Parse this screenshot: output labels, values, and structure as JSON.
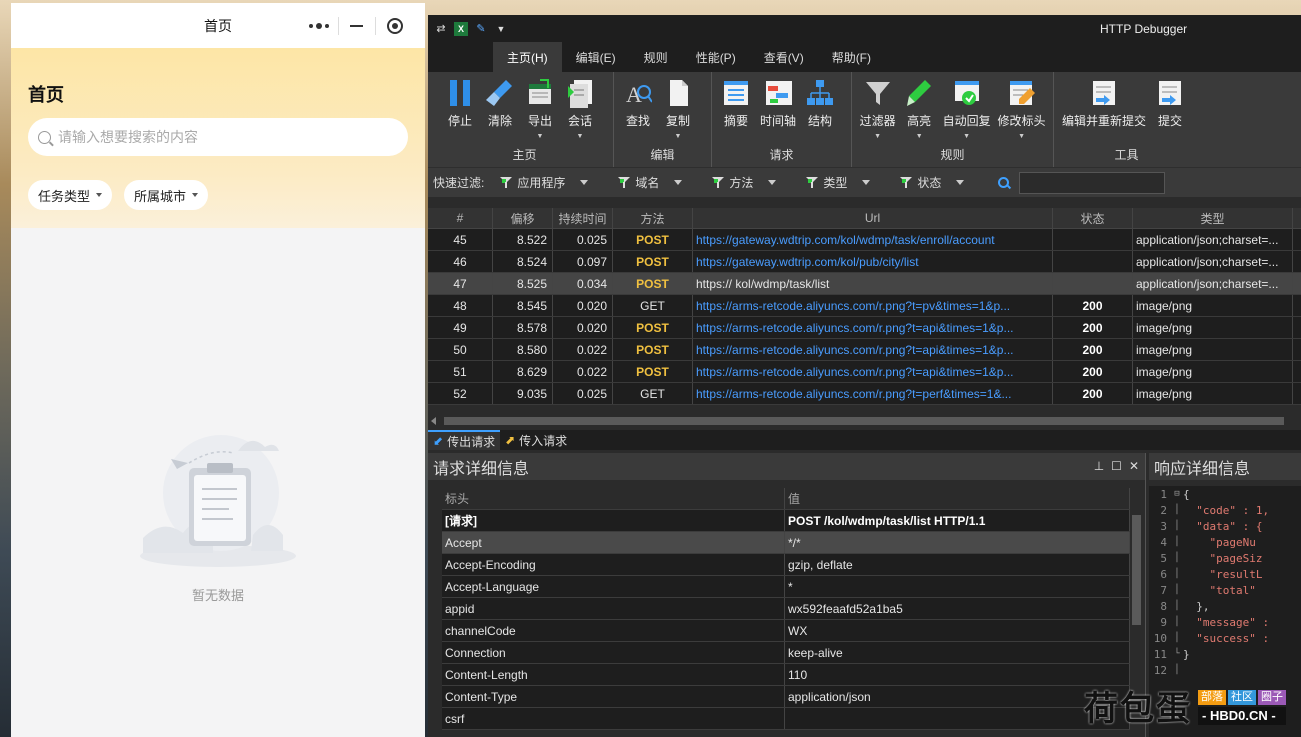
{
  "miniprogram": {
    "nav_title": "首页",
    "page_heading": "首页",
    "search_placeholder": "请输入想要搜索的内容",
    "filters": [
      "任务类型",
      "所属城市"
    ],
    "empty_text": "暂无数据",
    "capsule_icons": [
      "more-dots-icon",
      "minimize-icon",
      "close-target-icon"
    ]
  },
  "debugger": {
    "title": "HTTP Debugger",
    "menu": [
      "主页(H)",
      "编辑(E)",
      "规则",
      "性能(P)",
      "查看(V)",
      "帮助(F)"
    ],
    "ribbon_groups": [
      {
        "name": "主页",
        "buttons": [
          "停止",
          "清除",
          "导出",
          "会话"
        ]
      },
      {
        "name": "编辑",
        "buttons": [
          "查找",
          "复制"
        ]
      },
      {
        "name": "请求",
        "buttons": [
          "摘要",
          "时间轴",
          "结构"
        ]
      },
      {
        "name": "规则",
        "buttons": [
          "过滤器",
          "高亮",
          "自动回复",
          "修改标头"
        ]
      },
      {
        "name": "工具",
        "buttons": [
          "编辑并重新提交",
          "提交"
        ]
      }
    ],
    "filter_bar": {
      "label": "快速过滤:",
      "items": [
        "应用程序",
        "域名",
        "方法",
        "类型",
        "状态"
      ]
    },
    "table": {
      "headers": [
        "#",
        "偏移",
        "持续时间",
        "方法",
        "Url",
        "状态",
        "类型"
      ],
      "rows": [
        [
          "45",
          "8.522",
          "0.025",
          "POST",
          "https://gateway.wdtrip.com/kol/wdmp/task/enroll/account",
          "",
          "application/json;charset=..."
        ],
        [
          "46",
          "8.524",
          "0.097",
          "POST",
          "https://gateway.wdtrip.com/kol/pub/city/list",
          "",
          "application/json;charset=..."
        ],
        [
          "47",
          "8.525",
          "0.034",
          "POST",
          "https://                        kol/wdmp/task/list",
          "",
          "application/json;charset=..."
        ],
        [
          "48",
          "8.545",
          "0.020",
          "GET",
          "https://arms-retcode.aliyuncs.com/r.png?t=pv&times=1&p...",
          "200",
          "image/png"
        ],
        [
          "49",
          "8.578",
          "0.020",
          "POST",
          "https://arms-retcode.aliyuncs.com/r.png?t=api&times=1&p...",
          "200",
          "image/png"
        ],
        [
          "50",
          "8.580",
          "0.022",
          "POST",
          "https://arms-retcode.aliyuncs.com/r.png?t=api&times=1&p...",
          "200",
          "image/png"
        ],
        [
          "51",
          "8.629",
          "0.022",
          "POST",
          "https://arms-retcode.aliyuncs.com/r.png?t=api&times=1&p...",
          "200",
          "image/png"
        ],
        [
          "52",
          "9.035",
          "0.025",
          "GET",
          "https://arms-retcode.aliyuncs.com/r.png?t=perf&times=1&...",
          "200",
          "image/png"
        ]
      ]
    },
    "direction_tabs": [
      "传出请求",
      "传入请求"
    ],
    "request_panel": {
      "title": "请求详细信息",
      "col_key": "标头",
      "col_val": "值",
      "rows": [
        [
          "[请求]",
          "POST /kol/wdmp/task/list HTTP/1.1"
        ],
        [
          "Accept",
          "*/*"
        ],
        [
          "Accept-Encoding",
          "gzip, deflate"
        ],
        [
          "Accept-Language",
          "*"
        ],
        [
          "appid",
          "wx592feaafd52a1ba5"
        ],
        [
          "channelCode",
          "WX"
        ],
        [
          "Connection",
          "keep-alive"
        ],
        [
          "Content-Length",
          "110"
        ],
        [
          "Content-Type",
          "application/json"
        ],
        [
          "csrf",
          ""
        ]
      ],
      "controls": [
        "pin-icon",
        "maximize-icon",
        "close-icon"
      ]
    },
    "response_panel": {
      "title": "响应详细信息",
      "line_numbers": [
        "1",
        "2",
        "3",
        "4",
        "5",
        "6",
        "7",
        "8",
        "9",
        "10",
        "11",
        "12"
      ],
      "lines": [
        "{",
        "  \"code\" : 1,",
        "  \"data\" : {",
        "    \"pageNu",
        "    \"pageSiz",
        "    \"resultL",
        "    \"total\"",
        "  },",
        "  \"message\" :",
        "  \"success\" :",
        "}",
        ""
      ]
    }
  },
  "watermark": {
    "brand": "荷包蛋",
    "badges": [
      "部落",
      "社区",
      "圈子"
    ],
    "domain": "- HBD0.CN -",
    "badge_colors": [
      "#f39c12",
      "#3498db",
      "#9b59b6"
    ]
  }
}
